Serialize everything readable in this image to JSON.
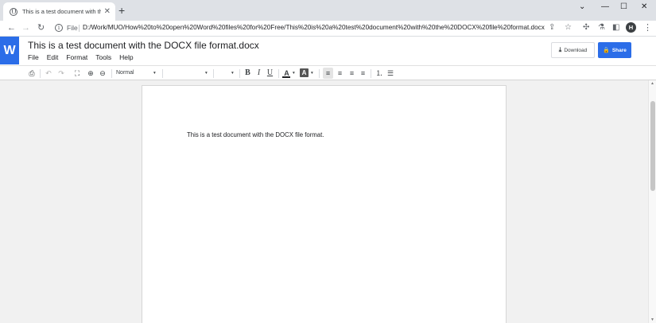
{
  "browser": {
    "tab": {
      "title": "This is a test document with the DOCX file format.docx",
      "close_glyph": "✕",
      "favicon": "globe-icon"
    },
    "new_tab_glyph": "+",
    "window_controls": {
      "chevron": "⌄",
      "minimize": "—",
      "maximize": "☐",
      "close": "✕"
    },
    "nav": {
      "back": "←",
      "forward": "→",
      "reload": "↻"
    },
    "address": {
      "info_glyph": "i",
      "scheme_label": "File",
      "url": "D:/Work/MUO/How%20to%20open%20Word%20files%20for%20Free/This%20is%20a%20test%20document%20with%20the%20DOCX%20file%20format.docx"
    },
    "toolbar_icons": {
      "share": "⇪",
      "bookmark": "☆",
      "extensions": "✣",
      "flask": "⚗",
      "sidepanel": "◧"
    },
    "profile_initial": "H",
    "menu_glyph": "⋮"
  },
  "app": {
    "logo_letter": "W",
    "brand_color": "#2b6de8",
    "document_title": "This is a test document with the DOCX file format.docx",
    "menu": [
      "File",
      "Edit",
      "Format",
      "Tools",
      "Help"
    ],
    "download_label": "Download",
    "download_glyph": "⤓",
    "share_label": "Share",
    "share_glyph": "🔒"
  },
  "editor_toolbar": {
    "print": "⎙",
    "undo": "↶",
    "redo": "↷",
    "fit": "⛶",
    "zoom_in": "⊕",
    "zoom_out": "⊖",
    "style_value": "Normal",
    "font_value": "",
    "size_value": "",
    "caret": "▾",
    "bold": "B",
    "italic": "I",
    "underline": "U",
    "text_color_glyph": "A",
    "highlight_glyph": "A",
    "align_left": "≡",
    "align_center": "≡",
    "align_right": "≡",
    "justify": "≡",
    "numbered_list": "⒈",
    "bulleted_list": "☰"
  },
  "document": {
    "body_text": "This is a test document with the DOCX file format."
  }
}
